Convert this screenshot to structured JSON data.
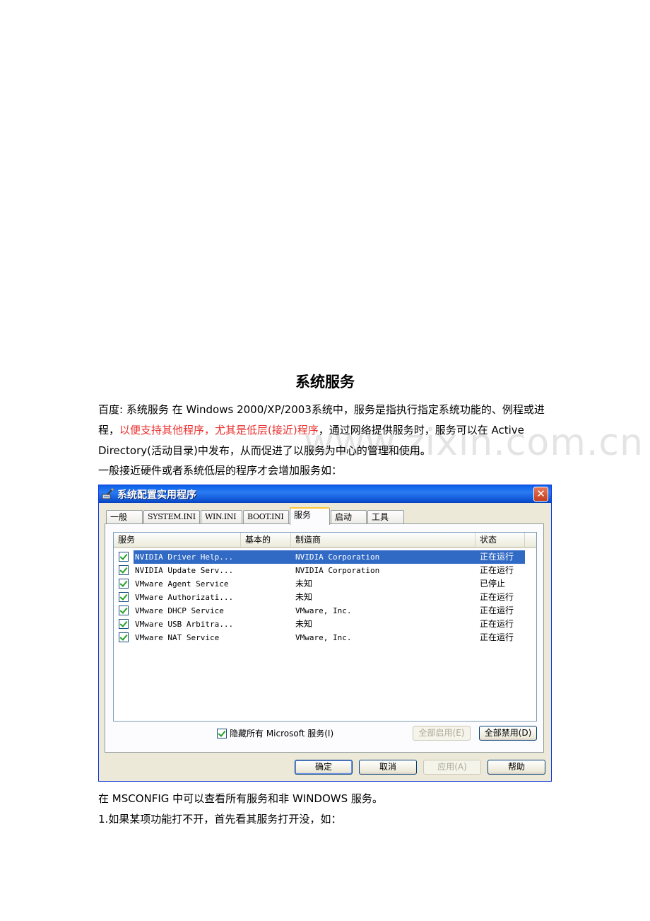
{
  "doc": {
    "title": "系统服务",
    "p1_a": "百度: 系统服务    在 Windows 2000/XP/2003系统中，服务是指执行指定系统功能的、例程或进程，",
    "p1_red": "以便支持其他程序，尤其是低层(接近)程序",
    "p1_b": "，通过网络提供服务时，服务可以在 Active Directory(活动目录)中发布，从而促进了以服务为中心的管理和使用。",
    "p2": "一般接近硬件或者系统低层的程序才会增加服务如：",
    "p3": "在 MSCONFIG 中可以查看所有服务和非 WINDOWS 服务。",
    "p4": "1.如果某项功能打不开，首先看其服务打开没，如：",
    "watermark": "www.zixin.com.cn"
  },
  "dialog": {
    "title": "系统配置实用程序",
    "close": "✕",
    "tabs": [
      "一般",
      "SYSTEM.INI",
      "WIN.INI",
      "BOOT.INI",
      "服务",
      "启动",
      "工具"
    ],
    "active_tab": "服务",
    "columns": {
      "service": "服务",
      "essential": "基本的",
      "manufacturer": "制造商",
      "status": "状态"
    },
    "rows": [
      {
        "name": "NVIDIA Driver Help...",
        "manufacturer": "NVIDIA Corporation",
        "status": "正在运行",
        "checked": true,
        "selected": true
      },
      {
        "name": "NVIDIA Update Serv...",
        "manufacturer": "NVIDIA Corporation",
        "status": "正在运行",
        "checked": true
      },
      {
        "name": "VMware Agent Service",
        "manufacturer": "未知",
        "status": "已停止",
        "checked": true
      },
      {
        "name": "VMware Authorizati...",
        "manufacturer": "未知",
        "status": "正在运行",
        "checked": true
      },
      {
        "name": "VMware DHCP Service",
        "manufacturer": "VMware, Inc.",
        "status": "正在运行",
        "checked": true
      },
      {
        "name": "VMware USB Arbitra...",
        "manufacturer": "未知",
        "status": "正在运行",
        "checked": true
      },
      {
        "name": "VMware NAT Service",
        "manufacturer": "VMware, Inc.",
        "status": "正在运行",
        "checked": true
      }
    ],
    "hide_ms": "隐藏所有 Microsoft 服务(I)",
    "enable_all": "全部启用(E)",
    "disable_all": "全部禁用(D)",
    "ok": "确定",
    "cancel": "取消",
    "apply": "应用(A)",
    "help": "帮助"
  }
}
